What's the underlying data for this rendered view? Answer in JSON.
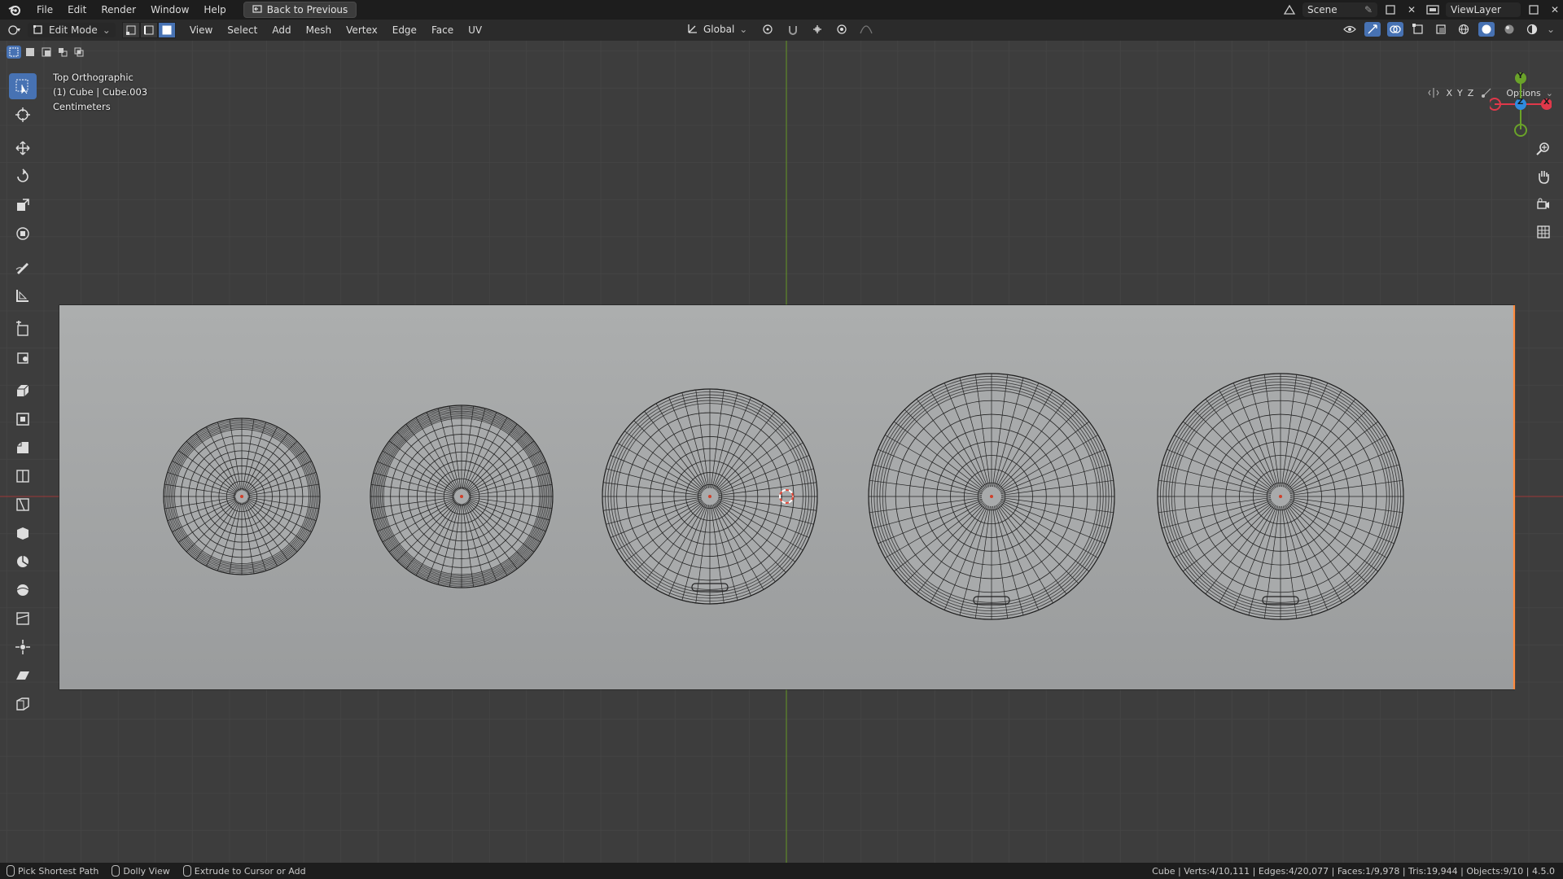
{
  "topbar": {
    "menus": [
      "File",
      "Edit",
      "Render",
      "Window",
      "Help"
    ],
    "back_button": "Back to Previous",
    "scene_label": "Scene",
    "view_layer_label": "ViewLayer"
  },
  "header": {
    "mode": "Edit Mode",
    "menus": [
      "View",
      "Select",
      "Add",
      "Mesh",
      "Vertex",
      "Edge",
      "Face",
      "UV"
    ],
    "transform_orientation": "Global",
    "options_label": "Options",
    "axis_labels": [
      "X",
      "Y",
      "Z"
    ]
  },
  "viewport": {
    "view_name": "Top Orthographic",
    "object_info": "(1) Cube | Cube.003",
    "units": "Centimeters"
  },
  "gizmo": {
    "y_label": "Y",
    "z_label": "Z",
    "x_label": "X",
    "colors": {
      "x": "#e0384a",
      "y": "#6aa329",
      "z": "#2f8be0"
    }
  },
  "statusbar": {
    "hint_left": "Pick Shortest Path",
    "hint_middle": "Dolly View",
    "hint_right": "Extrude to Cursor or Add",
    "stats": "Cube | Verts:4/10,111 | Edges:4/20,077 | Faces:1/9,978 | Tris:19,944 | Objects:9/10 | 4.5.0"
  },
  "colors": {
    "accent": "#4772b3",
    "viewport_bg": "#3d3d3d",
    "mesh_face": "#a6a8a9",
    "selected_edge": "#ff8a3d"
  }
}
